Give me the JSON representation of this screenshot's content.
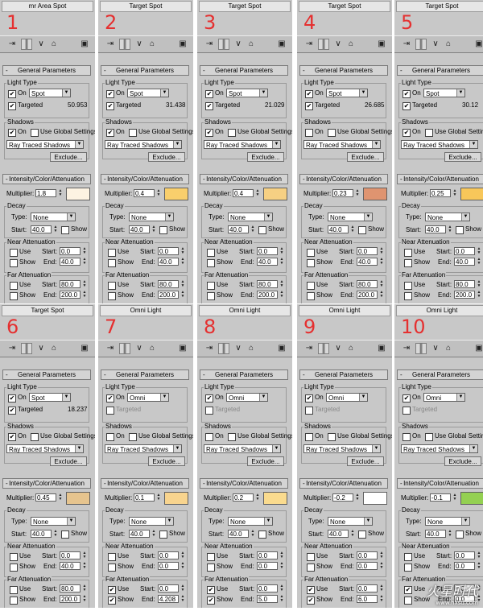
{
  "labels": {
    "general": "General Parameters",
    "light_type": "Light Type",
    "on": "On",
    "targeted": "Targeted",
    "shadows": "Shadows",
    "use_global": "Use Global Settings",
    "shadow_type": "Ray Traced Shadows",
    "exclude": "Exclude...",
    "ica": "Intensity/Color/Attenuation",
    "multiplier": "Multiplier:",
    "decay": "Decay",
    "type": "Type:",
    "decay_type": "None",
    "start": "Start:",
    "end": "End:",
    "show": "Show",
    "use": "Use",
    "near": "Near Attenuation",
    "far": "Far Attenuation",
    "rollout_mark": "-"
  },
  "panels": [
    {
      "num": "1",
      "title": "mr Area Spot",
      "light": "Spot",
      "targeted": "50.953",
      "targeted_on": true,
      "shadow_on": true,
      "multiplier": "1.8",
      "color": "#fdf3e2",
      "decay_start": "40.0",
      "near_start": "0.0",
      "near_end": "40.0",
      "far_start": "80.0",
      "far_end": "200.0",
      "far_use": false,
      "far_show": false
    },
    {
      "num": "2",
      "title": "Target Spot",
      "light": "Spot",
      "targeted": "31.438",
      "targeted_on": true,
      "shadow_on": true,
      "multiplier": "0.4",
      "color": "#f9cf6c",
      "decay_start": "40.0",
      "near_start": "0.0",
      "near_end": "40.0",
      "far_start": "80.0",
      "far_end": "200.0",
      "far_use": false,
      "far_show": false
    },
    {
      "num": "3",
      "title": "Target Spot",
      "light": "Spot",
      "targeted": "21.029",
      "targeted_on": true,
      "shadow_on": true,
      "multiplier": "0.4",
      "color": "#f6d083",
      "decay_start": "40.0",
      "near_start": "0.0",
      "near_end": "40.0",
      "far_start": "80.0",
      "far_end": "200.0",
      "far_use": false,
      "far_show": false
    },
    {
      "num": "4",
      "title": "Target Spot",
      "light": "Spot",
      "targeted": "26.685",
      "targeted_on": true,
      "shadow_on": false,
      "multiplier": "0.23",
      "color": "#df9470",
      "decay_start": "40.0",
      "near_start": "0.0",
      "near_end": "40.0",
      "far_start": "80.0",
      "far_end": "200.0",
      "far_use": false,
      "far_show": false
    },
    {
      "num": "5",
      "title": "Target Spot",
      "light": "Spot",
      "targeted": "30.12",
      "targeted_on": true,
      "shadow_on": true,
      "multiplier": "0.25",
      "color": "#f8c75a",
      "decay_start": "40.0",
      "near_start": "0.0",
      "near_end": "40.0",
      "far_start": "80.0",
      "far_end": "200.0",
      "far_use": false,
      "far_show": false
    },
    {
      "num": "6",
      "title": "Target Spot",
      "light": "Spot",
      "targeted": "18.237",
      "targeted_on": true,
      "shadow_on": true,
      "multiplier": "0.45",
      "color": "#e6c48e",
      "decay_start": "40.0",
      "near_start": "0.0",
      "near_end": "40.0",
      "far_start": "80.0",
      "far_end": "200.0",
      "far_use": false,
      "far_show": false
    },
    {
      "num": "7",
      "title": "Omni Light",
      "light": "Omni",
      "targeted": "",
      "targeted_on": false,
      "shadow_on": false,
      "multiplier": "0.1",
      "color": "#f8d48e",
      "decay_start": "40.0",
      "near_start": "0.0",
      "near_end": "0.0",
      "far_start": "0.0",
      "far_end": "4.208",
      "far_use": true,
      "far_show": true
    },
    {
      "num": "8",
      "title": "Omni Light",
      "light": "Omni",
      "targeted": "",
      "targeted_on": false,
      "shadow_on": false,
      "multiplier": "0.2",
      "color": "#fadb8e",
      "decay_start": "40.0",
      "near_start": "0.0",
      "near_end": "0.0",
      "far_start": "0.0",
      "far_end": "5.0",
      "far_use": true,
      "far_show": true
    },
    {
      "num": "9",
      "title": "Omni Light",
      "light": "Omni",
      "targeted": "",
      "targeted_on": false,
      "shadow_on": false,
      "multiplier": "-0.2",
      "color": "#ffffff",
      "decay_start": "40.0",
      "near_start": "0.0",
      "near_end": "0.0",
      "far_start": "0.0",
      "far_end": "6.0",
      "far_use": true,
      "far_show": true
    },
    {
      "num": "10",
      "title": "Omni Light",
      "light": "Omni",
      "targeted": "",
      "targeted_on": false,
      "shadow_on": false,
      "multiplier": "-0.1",
      "color": "#94d052",
      "decay_start": "40.0",
      "near_start": "0.0",
      "near_end": "0.0",
      "far_start": "0.0",
      "far_end": "0.0",
      "far_use": true,
      "far_show": false
    }
  ],
  "watermark": {
    "main": "火星时代",
    "sub": "www.hxsd.com"
  }
}
